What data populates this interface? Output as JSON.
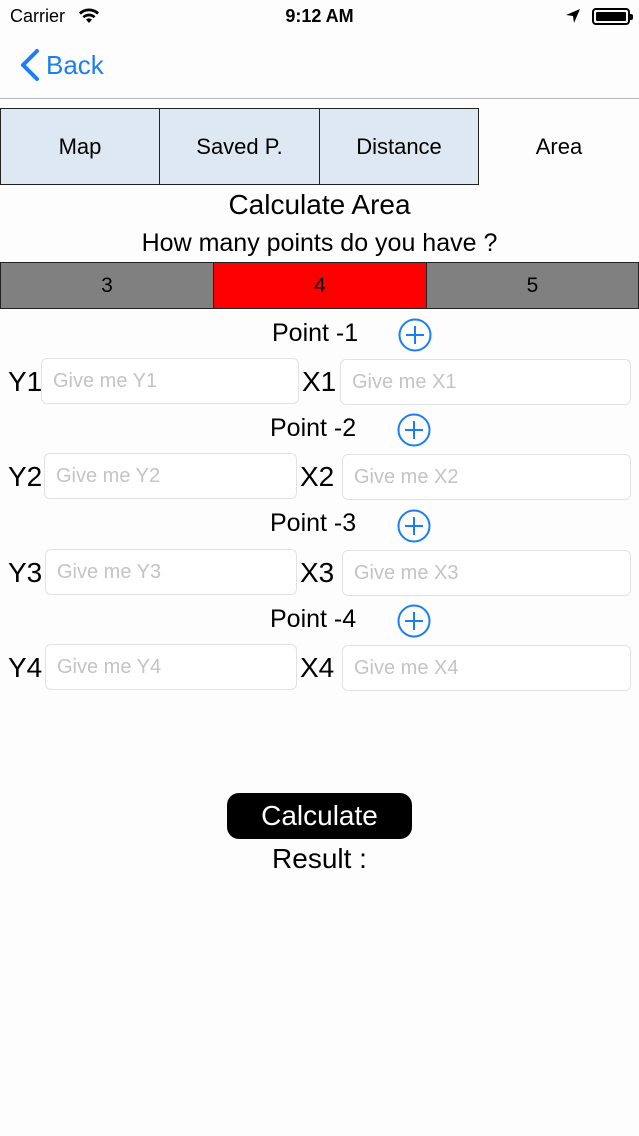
{
  "status": {
    "carrier": "Carrier",
    "time": "9:12 AM"
  },
  "nav": {
    "back_label": "Back"
  },
  "tabs": [
    {
      "label": "Map"
    },
    {
      "label": "Saved P."
    },
    {
      "label": "Distance"
    },
    {
      "label": "Area"
    }
  ],
  "title": "Calculate Area",
  "question": "How many points do you have ?",
  "segments": [
    {
      "label": "3"
    },
    {
      "label": "4"
    },
    {
      "label": "5"
    }
  ],
  "selected_segment": "4",
  "colors": {
    "accent": "#1a7ef5",
    "selected_segment": "#ff0000",
    "segment": "#808080",
    "tab_bg": "#dde8f2"
  },
  "points": [
    {
      "title": "Point -1",
      "y_label": "Y1",
      "y_placeholder": "Give me Y1",
      "x_label": "X1",
      "x_placeholder": "Give me X1"
    },
    {
      "title": "Point -2",
      "y_label": "Y2",
      "y_placeholder": "Give me Y2",
      "x_label": "X2",
      "x_placeholder": "Give me X2"
    },
    {
      "title": "Point -3",
      "y_label": "Y3",
      "y_placeholder": "Give me Y3",
      "x_label": "X3",
      "x_placeholder": "Give me X3"
    },
    {
      "title": "Point -4",
      "y_label": "Y4",
      "y_placeholder": "Give me Y4",
      "x_label": "X4",
      "x_placeholder": "Give me X4"
    }
  ],
  "calculate_label": "Calculate",
  "result_label": "Result :"
}
